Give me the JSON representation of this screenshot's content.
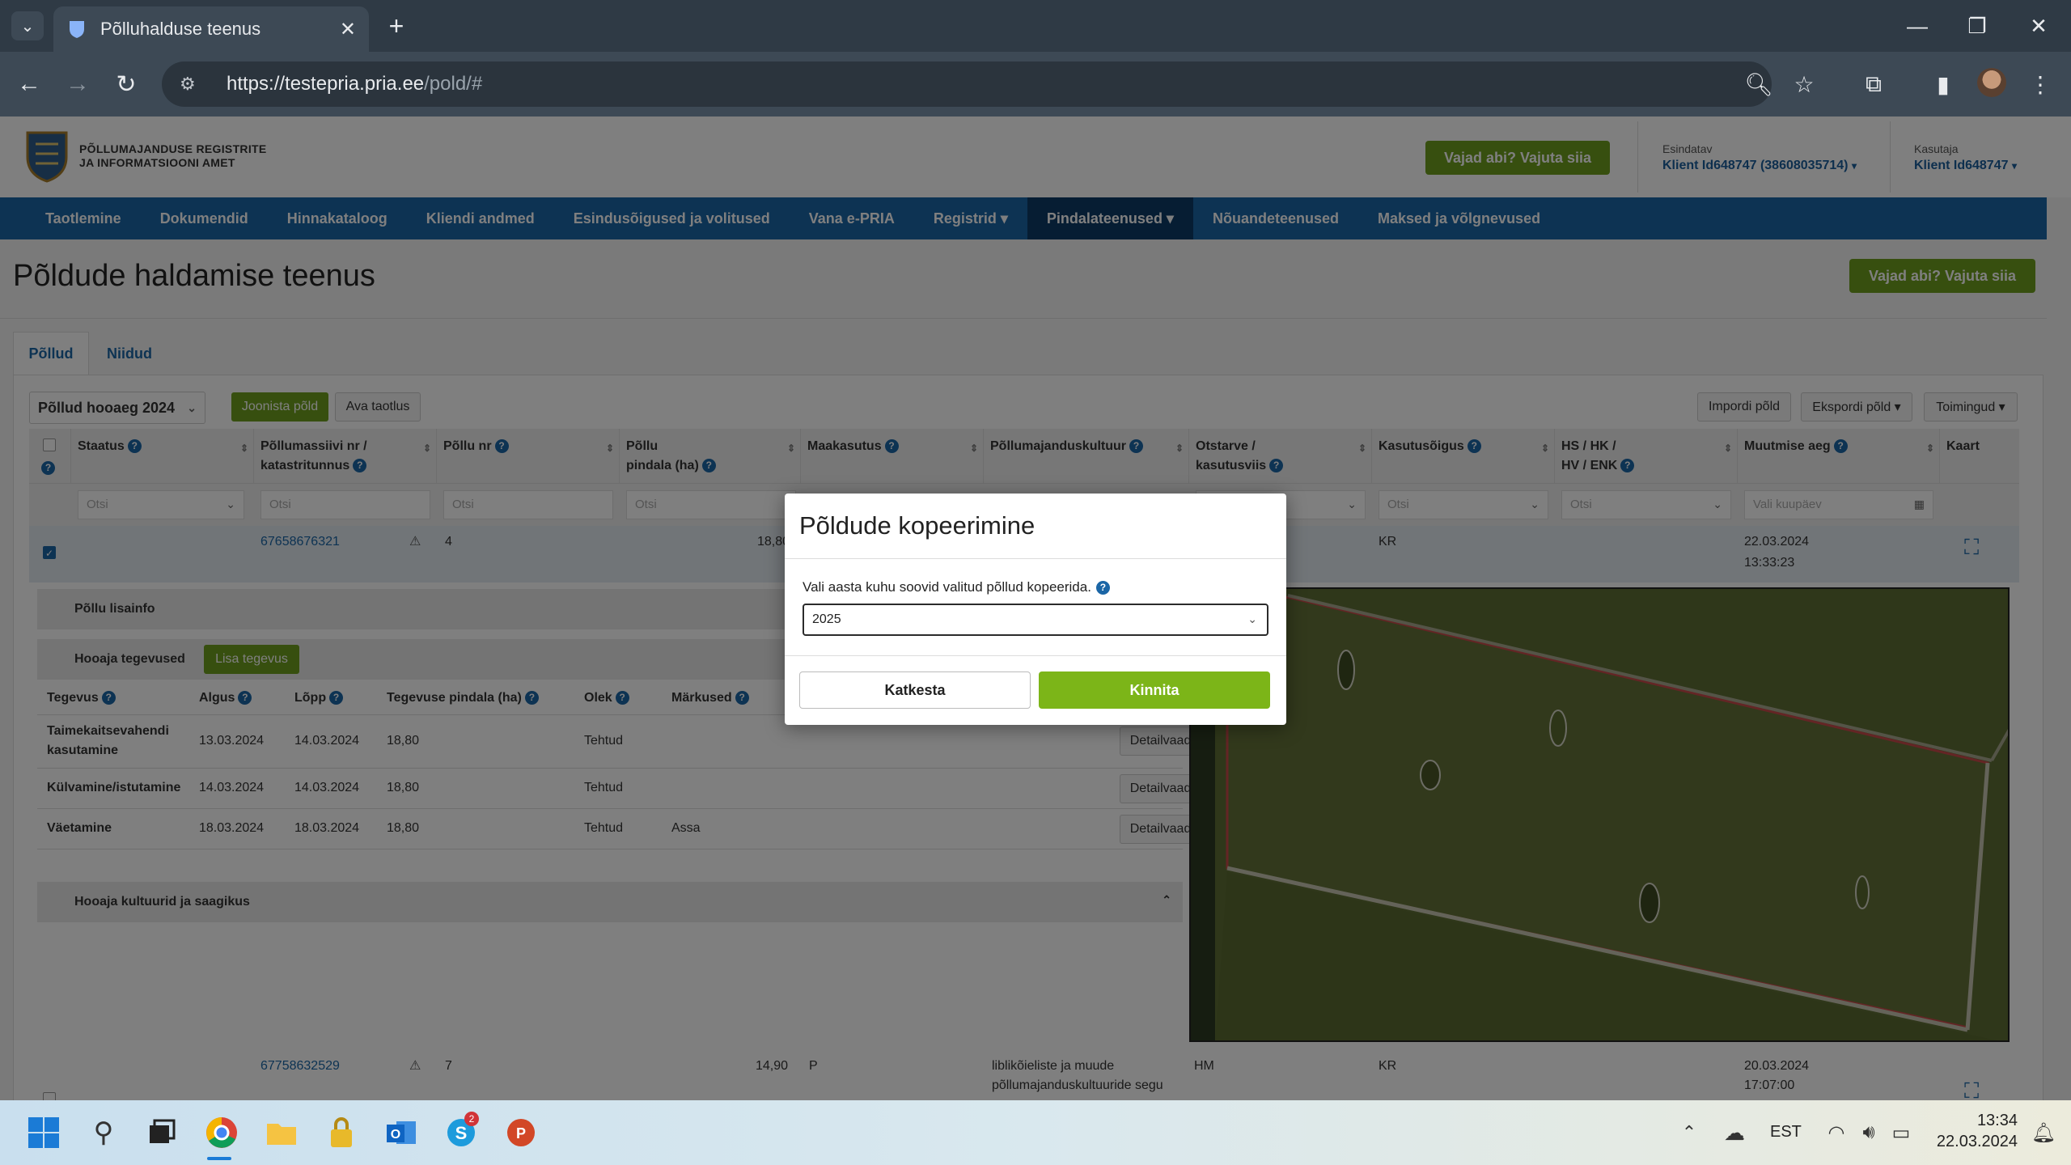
{
  "browser": {
    "tab_title": "Põlluhalduse teenus",
    "url_host": "https://testepria.pria.ee",
    "url_path": "/pold/#"
  },
  "header": {
    "logo_line1": "PÕLLUMAJANDUSE REGISTRITE",
    "logo_line2": "JA INFORMATSIOONI AMET",
    "help_label": "Vajad abi? Vajuta siia",
    "representative_label": "Esindatav",
    "representative_value": "Klient Id648747 (38608035714)",
    "user_label": "Kasutaja",
    "user_value": "Klient Id648747"
  },
  "nav": {
    "items": [
      {
        "label": "Taotlemine"
      },
      {
        "label": "Dokumendid"
      },
      {
        "label": "Hinnakataloog"
      },
      {
        "label": "Kliendi andmed"
      },
      {
        "label": "Esindusõigused ja volitused"
      },
      {
        "label": "Vana e-PRIA"
      },
      {
        "label": "Registrid ▾"
      },
      {
        "label": "Pindalateenused ▾"
      },
      {
        "label": "Nõuandeteenused"
      },
      {
        "label": "Maksed ja võlgnevused"
      }
    ]
  },
  "page": {
    "title": "Põldude haldamise teenus",
    "help_label": "Vajad abi? Vajuta siia",
    "tab_fields": "Põllud",
    "tab_meadows": "Niidud"
  },
  "toolbar": {
    "season_select": "Põllud hooaeg 2024",
    "draw_field": "Joonista põld",
    "open_application": "Ava taotlus",
    "import_field": "Impordi põld",
    "export_field": "Ekspordi põld ▾",
    "actions": "Toimingud ▾"
  },
  "grid": {
    "headers": {
      "status": "Staatus",
      "massif_1": "Põllumassiivi nr /",
      "massif_2": "katastritunnus",
      "field_no": "Põllu nr",
      "area_1": "Põllu",
      "area_2": "pindala (ha)",
      "land_use": "Maakasutus",
      "crop": "Põllumajanduskultuur",
      "purpose_1": "Otstarve /",
      "purpose_2": "kasutusviis",
      "usage_right": "Kasutusõigus",
      "hs_1": "HS / HK /",
      "hs_2": "HV / ENK",
      "modified": "Muutmise aeg",
      "map": "Kaart"
    },
    "filter_placeholder": "Otsi",
    "date_placeholder": "Vali kuupäev",
    "rows": [
      {
        "massif": "67658676321",
        "field_no": "4",
        "area": "18,80",
        "usage_right": "KR",
        "modified_date": "22.03.2024",
        "modified_time": "13:33:23"
      },
      {
        "massif": "67758632529",
        "field_no": "7",
        "area": "14,90",
        "land_use": "P",
        "crop_1": "liblikõieliste ja muude",
        "crop_2": "põllumajanduskultuuride segu",
        "purpose": "HM",
        "usage_right": "KR",
        "modified_date": "20.03.2024",
        "modified_time": "17:07:00"
      }
    ]
  },
  "detail": {
    "extra_info": "Põllu lisainfo",
    "season_activities": "Hooaja tegevused",
    "add_activity": "Lisa tegevus",
    "crops_section": "Hooaja kultuurid ja saagikus",
    "activity_headers": {
      "activity": "Tegevus",
      "start": "Algus",
      "end": "Lõpp",
      "area": "Tegevuse pindala (ha)",
      "state": "Olek",
      "notes": "Märkused"
    },
    "detail_btn": "Detailvaade",
    "activities": [
      {
        "name_1": "Taimekaitsevahendi",
        "name_2": "kasutamine",
        "start": "13.03.2024",
        "end": "14.03.2024",
        "area": "18,80",
        "state": "Tehtud",
        "notes": ""
      },
      {
        "name_1": "Külvamine/istutamine",
        "name_2": "",
        "start": "14.03.2024",
        "end": "14.03.2024",
        "area": "18,80",
        "state": "Tehtud",
        "notes": ""
      },
      {
        "name_1": "Väetamine",
        "name_2": "",
        "start": "18.03.2024",
        "end": "18.03.2024",
        "area": "18,80",
        "state": "Tehtud",
        "notes": "Assa"
      }
    ]
  },
  "modal": {
    "title": "Põldude kopeerimine",
    "label": "Vali aasta kuhu soovid valitud põllud kopeerida.",
    "selected_year": "2025",
    "cancel": "Katkesta",
    "confirm": "Kinnita"
  },
  "taskbar": {
    "language": "EST",
    "time": "13:34",
    "date": "22.03.2024",
    "skype_badge": "2"
  }
}
